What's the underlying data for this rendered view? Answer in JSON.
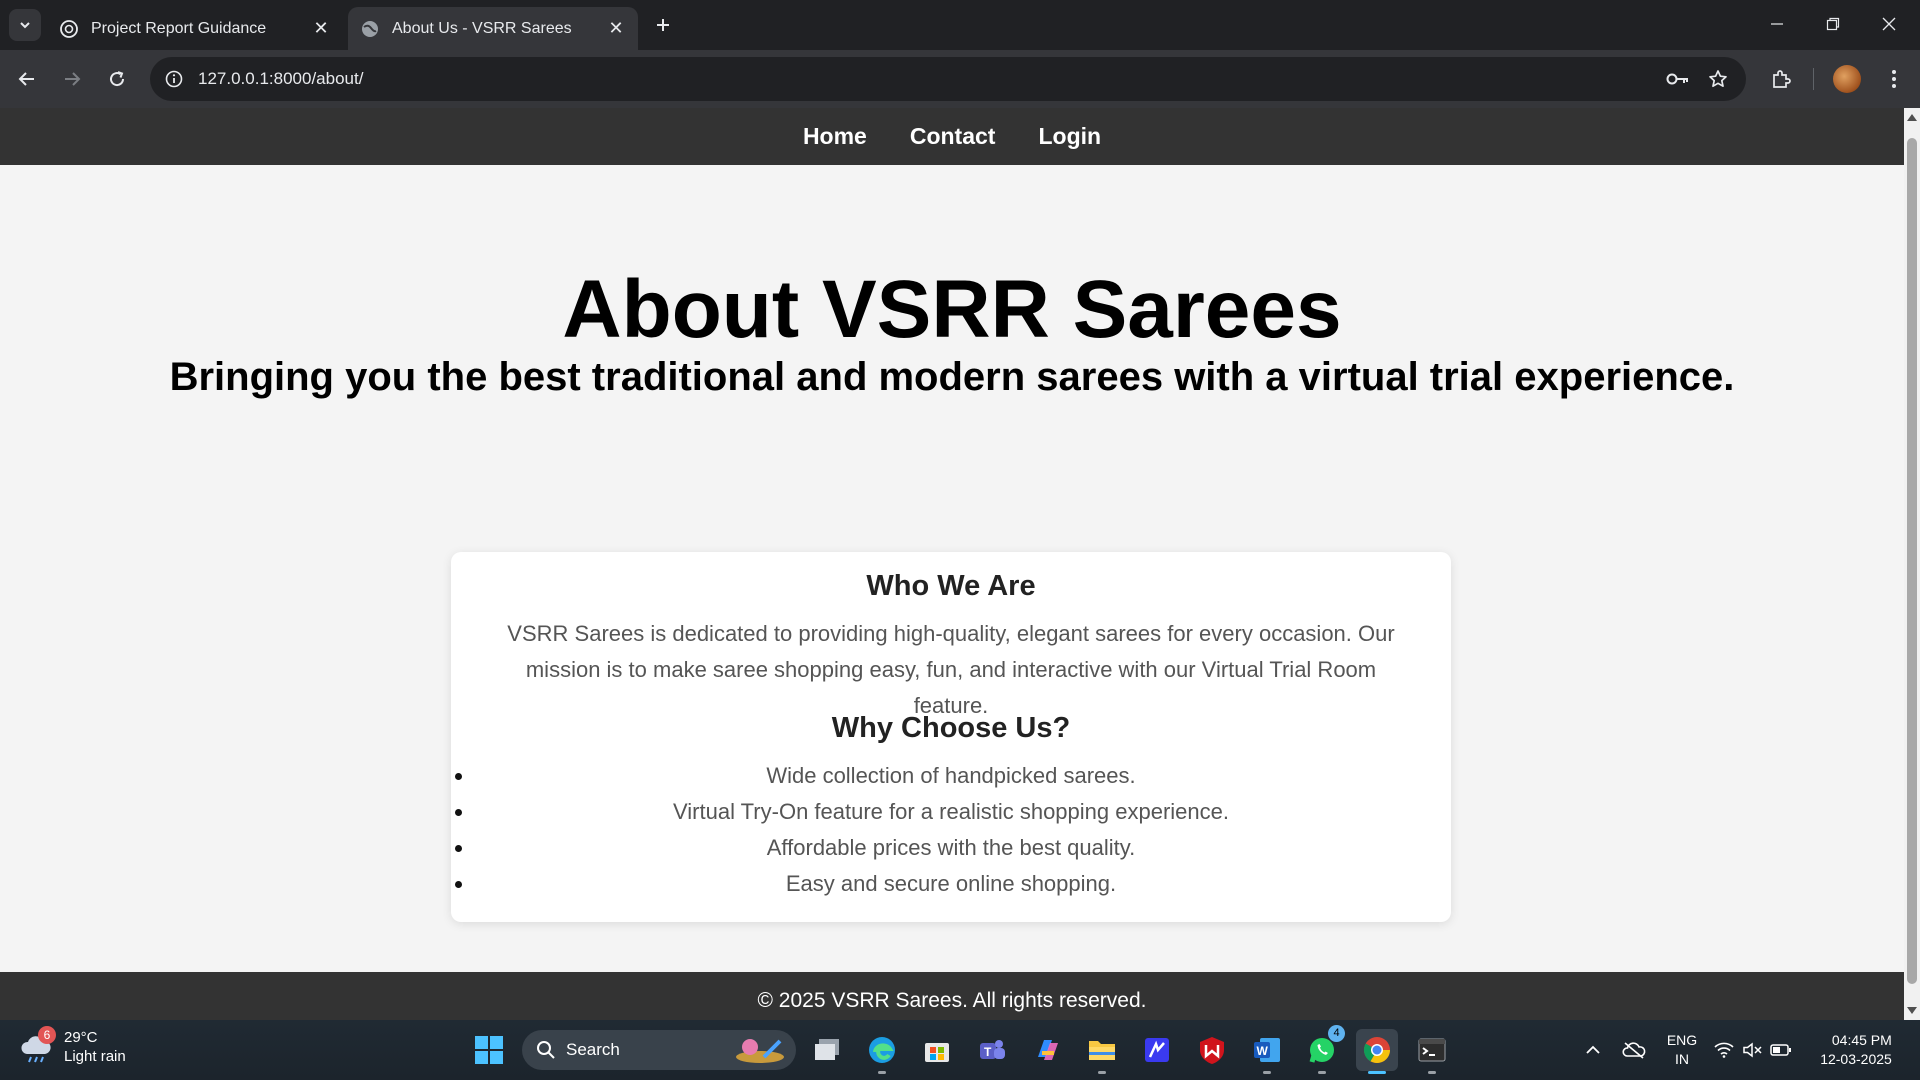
{
  "browser": {
    "tabs": [
      {
        "title": "Project Report Guidance",
        "active": false
      },
      {
        "title": "About Us - VSRR Sarees",
        "active": true
      }
    ],
    "url": "127.0.0.1:8000/about/"
  },
  "site": {
    "nav": [
      "Home",
      "Contact",
      "Login"
    ],
    "hero": {
      "title": "About VSRR Sarees",
      "subtitle": "Bringing you the best traditional and modern sarees with a virtual trial experience."
    },
    "who_we_are": {
      "heading": "Who We Are",
      "text": "VSRR Sarees is dedicated to providing high-quality, elegant sarees for every occasion. Our mission is to make saree shopping easy, fun, and interactive with our Virtual Trial Room feature."
    },
    "why_choose_us": {
      "heading": "Why Choose Us?",
      "items": [
        "Wide collection of handpicked sarees.",
        "Virtual Try-On feature for a realistic shopping experience.",
        "Affordable prices with the best quality.",
        "Easy and secure online shopping."
      ]
    },
    "footer": "© 2025 VSRR Sarees. All rights reserved."
  },
  "taskbar": {
    "weather": {
      "temp": "29°C",
      "condition": "Light rain",
      "alert_count": "6"
    },
    "search_label": "Search",
    "whatsapp_badge": "4",
    "language": {
      "line1": "ENG",
      "line2": "IN"
    },
    "clock": {
      "time": "04:45 PM",
      "date": "12-03-2025"
    }
  },
  "colors": {
    "nav_bg": "#333333",
    "page_bg": "#f4f4f4",
    "card_bg": "#ffffff",
    "chrome_dark": "#202124",
    "chrome_toolbar": "#35363a"
  }
}
